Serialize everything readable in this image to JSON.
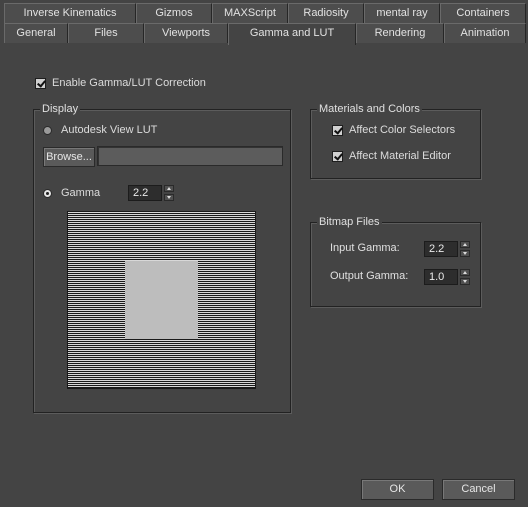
{
  "tabs": {
    "row1": [
      "Inverse Kinematics",
      "Gizmos",
      "MAXScript",
      "Radiosity",
      "mental ray",
      "Containers"
    ],
    "row2": [
      "General",
      "Files",
      "Viewports",
      "Gamma and LUT",
      "Rendering",
      "Animation"
    ],
    "active": "Gamma and LUT"
  },
  "enable_gamma": {
    "label": "Enable Gamma/LUT Correction",
    "checked": true
  },
  "display": {
    "title": "Display",
    "lut_label": "Autodesk View LUT",
    "lut_selected": false,
    "browse_label": "Browse...",
    "path_value": "",
    "gamma_label": "Gamma",
    "gamma_selected": true,
    "gamma_value": "2.2"
  },
  "materials": {
    "title": "Materials and Colors",
    "affect_color_selectors": {
      "label": "Affect Color Selectors",
      "checked": true
    },
    "affect_material_editor": {
      "label": "Affect Material Editor",
      "checked": true
    }
  },
  "bitmap": {
    "title": "Bitmap Files",
    "input_gamma_label": "Input Gamma:",
    "input_gamma_value": "2.2",
    "output_gamma_label": "Output Gamma:",
    "output_gamma_value": "1.0"
  },
  "buttons": {
    "ok": "OK",
    "cancel": "Cancel"
  },
  "colors": {
    "background": "#444444",
    "text": "#dcdcdc"
  }
}
